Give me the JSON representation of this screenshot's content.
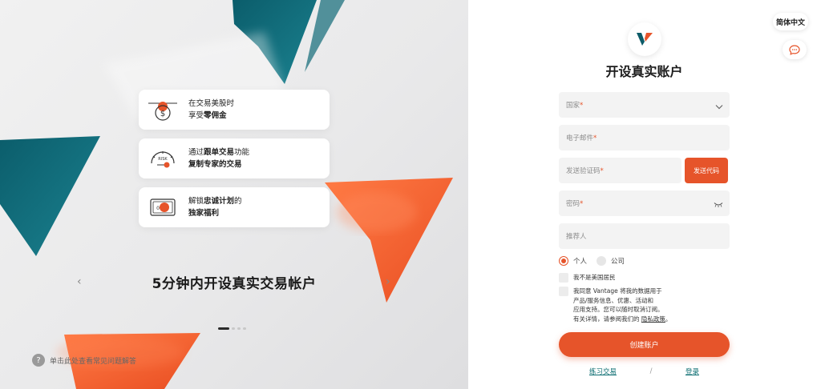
{
  "promo": {
    "features": [
      {
        "line1": "在交易美股时",
        "line2_prefix": "享受",
        "line2_bold": "零佣金",
        "icon": "dollar-chart-icon"
      },
      {
        "line1_prefix": "通过",
        "line1_bold": "跟单交易",
        "line1_suffix": "功能",
        "line2_bold": "复制专家的交易",
        "icon": "risk-gauge-icon"
      },
      {
        "line1_prefix": "解锁",
        "line1_bold": "忠诚计划",
        "line1_suffix": "的",
        "line2_bold": "独家福利",
        "icon": "reward-card-icon"
      }
    ],
    "title": "5分钟内开设真实交易帐户",
    "prev_arrow": "‹",
    "next_arrow": "›",
    "faq_icon": "?",
    "faq_text": "单击此处查看常见问题解答"
  },
  "header": {
    "language": "简体中文",
    "chat_icon": "chat-bubble-icon"
  },
  "form": {
    "title": "开设真实账户",
    "country_label": "国家",
    "email_label": "电子邮件",
    "code_label": "发送验证码",
    "send_code_button": "发送代码",
    "password_label": "密码",
    "referrer_label": "推荐人",
    "required_mark": "*",
    "account_type_personal": "个人",
    "account_type_company": "公司",
    "not_us_resident": "我不是美国居民",
    "consent_line1": "我同意 Vantage 将我的数据用于",
    "consent_line2": "产品/服务信息、优惠、活动和",
    "consent_line3": "应用支持。您可以随时取消订阅。",
    "consent_line4_prefix": "有关详情，请参阅我们的",
    "privacy_link": "隐私政策",
    "consent_line4_suffix": "。",
    "create_button": "创建账户",
    "demo_link": "练习交易",
    "separator": "/",
    "login_link": "登录"
  },
  "colors": {
    "accent": "#e6542a",
    "teal": "#0d6e72",
    "field_bg": "#f3f3f3"
  }
}
